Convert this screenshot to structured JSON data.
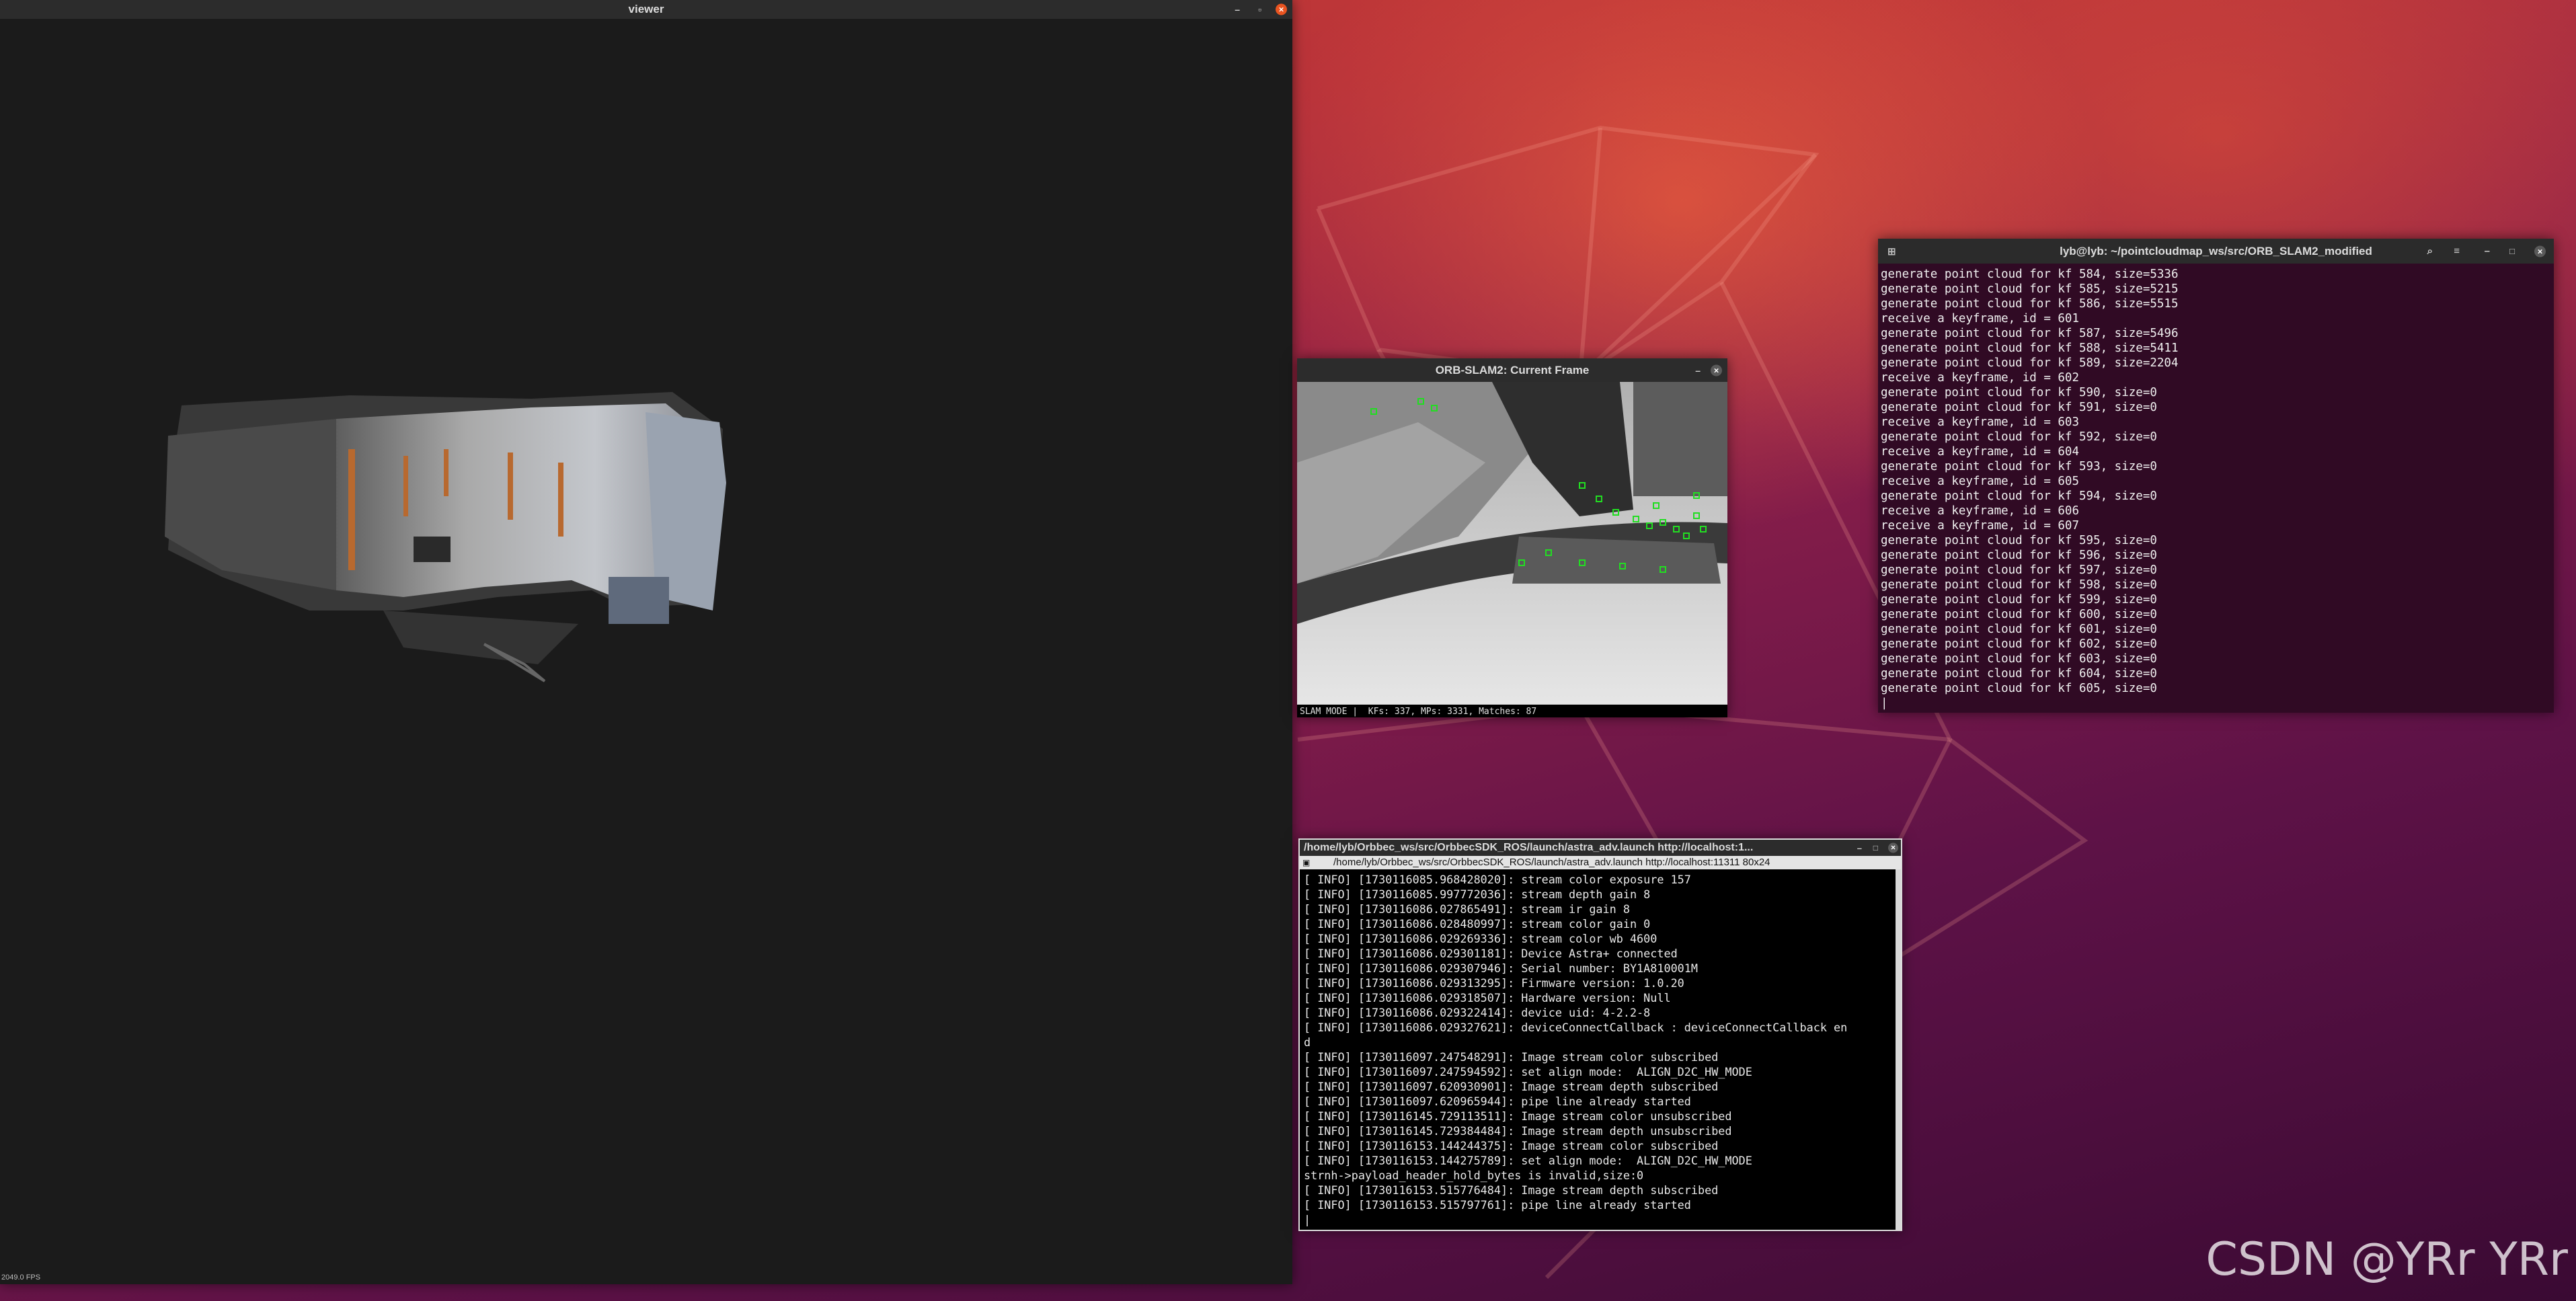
{
  "desktop": {
    "watermark": "CSDN @YRr YRr",
    "colors": {
      "orange": "#e95420",
      "aubergine": "#5e1247"
    }
  },
  "viewer": {
    "title": "viewer",
    "fps": "2049.0 FPS",
    "controls": {
      "minimize": "–",
      "maximize": "▫",
      "close": "×"
    }
  },
  "orb": {
    "title": "ORB-SLAM2: Current Frame",
    "status": "SLAM MODE |  KFs: 337, MPs: 3331, Matches: 87",
    "controls": {
      "minimize": "–",
      "close": "×"
    }
  },
  "term1": {
    "title": "lyb@lyb: ~/pointcloudmap_ws/src/ORB_SLAM2_modified",
    "icons": [
      "terminal-icon",
      "search-icon",
      "menu-icon"
    ],
    "lines": [
      "generate point cloud for kf 584, size=5336",
      "generate point cloud for kf 585, size=5215",
      "generate point cloud for kf 586, size=5515",
      "receive a keyframe, id = 601",
      "generate point cloud for kf 587, size=5496",
      "generate point cloud for kf 588, size=5411",
      "generate point cloud for kf 589, size=2204",
      "receive a keyframe, id = 602",
      "generate point cloud for kf 590, size=0",
      "generate point cloud for kf 591, size=0",
      "receive a keyframe, id = 603",
      "generate point cloud for kf 592, size=0",
      "receive a keyframe, id = 604",
      "generate point cloud for kf 593, size=0",
      "receive a keyframe, id = 605",
      "generate point cloud for kf 594, size=0",
      "receive a keyframe, id = 606",
      "receive a keyframe, id = 607",
      "generate point cloud for kf 595, size=0",
      "generate point cloud for kf 596, size=0",
      "generate point cloud for kf 597, size=0",
      "generate point cloud for kf 598, size=0",
      "generate point cloud for kf 599, size=0",
      "generate point cloud for kf 600, size=0",
      "generate point cloud for kf 601, size=0",
      "generate point cloud for kf 602, size=0",
      "generate point cloud for kf 603, size=0",
      "generate point cloud for kf 604, size=0",
      "generate point cloud for kf 605, size=0"
    ],
    "cursor": "|"
  },
  "term2": {
    "title": "/home/lyb/Orbbec_ws/src/OrbbecSDK_ROS/launch/astra_adv.launch http://localhost:1...",
    "subtitle": "/home/lyb/Orbbec_ws/src/OrbbecSDK_ROS/launch/astra_adv.launch http://localhost:11311 80x24",
    "lines": [
      "[ INFO] [1730116085.968428020]: stream color exposure 157",
      "[ INFO] [1730116085.997772036]: stream depth gain 8",
      "[ INFO] [1730116086.027865491]: stream ir gain 8",
      "[ INFO] [1730116086.028480997]: stream color gain 0",
      "[ INFO] [1730116086.029269336]: stream color wb 4600",
      "[ INFO] [1730116086.029301181]: Device Astra+ connected",
      "[ INFO] [1730116086.029307946]: Serial number: BY1A810001M",
      "[ INFO] [1730116086.029313295]: Firmware version: 1.0.20",
      "[ INFO] [1730116086.029318507]: Hardware version: Null",
      "[ INFO] [1730116086.029322414]: device uid: 4-2.2-8",
      "[ INFO] [1730116086.029327621]: deviceConnectCallback : deviceConnectCallback en",
      "d",
      "[ INFO] [1730116097.247548291]: Image stream color subscribed",
      "[ INFO] [1730116097.247594592]: set align mode:  ALIGN_D2C_HW_MODE",
      "[ INFO] [1730116097.620930901]: Image stream depth subscribed",
      "[ INFO] [1730116097.620965944]: pipe line already started",
      "[ INFO] [1730116145.729113511]: Image stream color unsubscribed",
      "[ INFO] [1730116145.729384484]: Image stream depth unsubscribed",
      "[ INFO] [1730116153.144244375]: Image stream color subscribed",
      "[ INFO] [1730116153.144275789]: set align mode:  ALIGN_D2C_HW_MODE",
      "strnh->payload_header_hold_bytes is invalid,size:0",
      "[ INFO] [1730116153.515776484]: Image stream depth subscribed",
      "[ INFO] [1730116153.515797761]: pipe line already started"
    ],
    "cursor": "|"
  }
}
